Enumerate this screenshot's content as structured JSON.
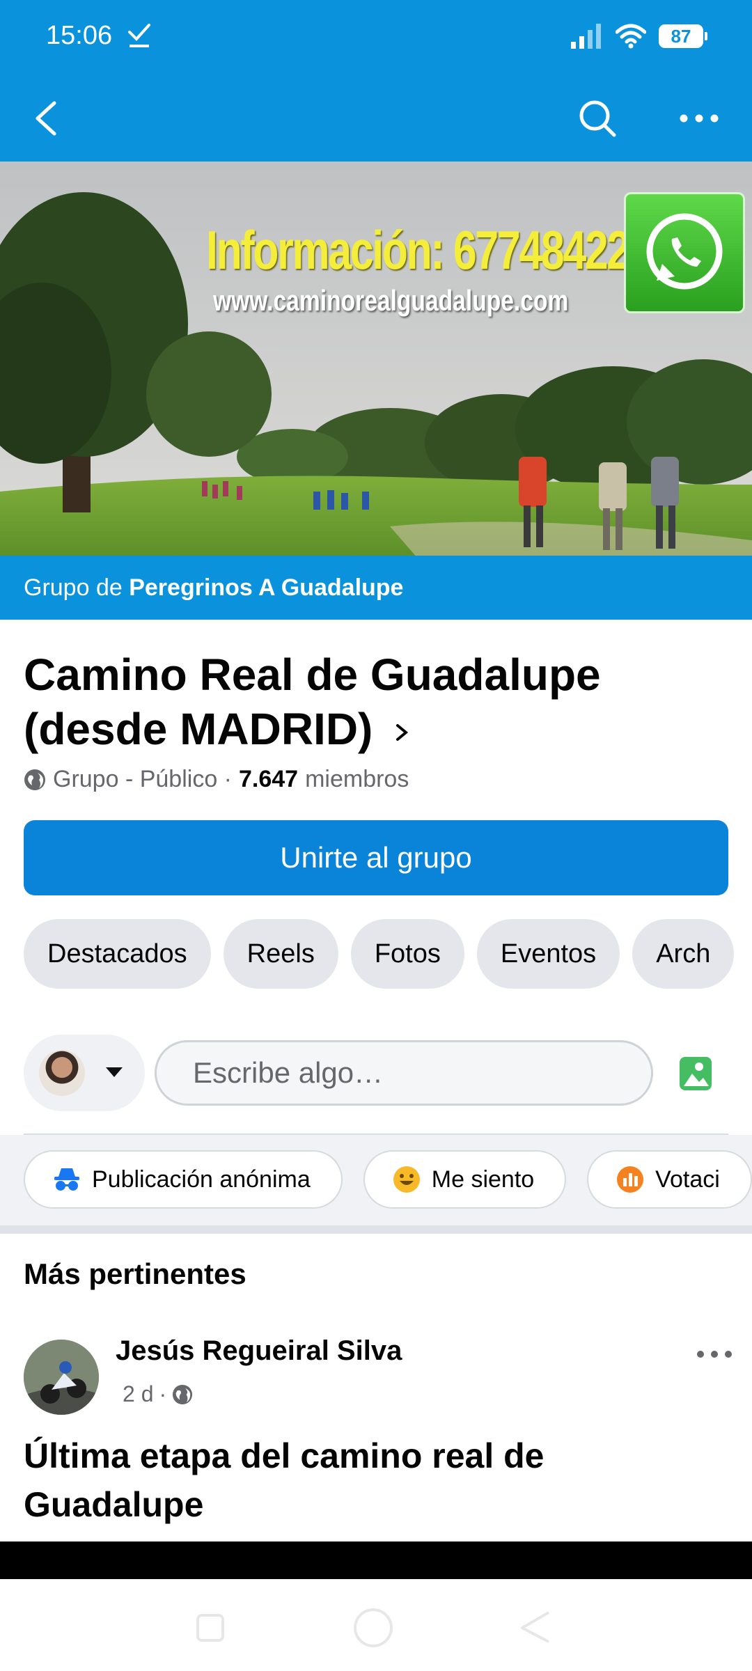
{
  "status_bar": {
    "time": "15:06",
    "battery": "87",
    "icons": [
      "check-icon",
      "signal-icon",
      "wifi-icon",
      "battery-icon"
    ]
  },
  "header": {
    "back_icon": "back-arrow-icon",
    "search_icon": "search-icon",
    "more_icon": "more-icon"
  },
  "cover": {
    "info_text": "Información: 677484227",
    "url_text": "www.caminorealguadalupe.com",
    "badge_icon": "whatsapp-icon"
  },
  "group_strip": {
    "prefix": "Grupo de ",
    "name": "Peregrinos A Guadalupe"
  },
  "group": {
    "title": "Camino Real de Guadalupe (desde MADRID)",
    "privacy": "Grupo - Público · ",
    "member_count": "7.647",
    "members_label": "miembros",
    "join_label": "Unirte al grupo"
  },
  "tabs": [
    "Destacados",
    "Reels",
    "Fotos",
    "Eventos",
    "Arch"
  ],
  "composer": {
    "placeholder": "Escribe algo…",
    "photo_icon": "photo-icon"
  },
  "actions": [
    {
      "label": "Publicación anónima",
      "icon": "incognito-icon",
      "color": "#1877f2"
    },
    {
      "label": "Me siento",
      "icon": "smiley-icon",
      "color": "#f7b928"
    },
    {
      "label": "Votaci",
      "icon": "poll-icon",
      "color": "#f5821f"
    }
  ],
  "feed": {
    "section_title": "Más pertinentes",
    "post": {
      "author": "Jesús Regueiral Silva",
      "time": "2 d",
      "separator": "·",
      "title": "Última etapa del camino real de Guadalupe"
    }
  },
  "colors": {
    "brand_blue": "#0a93dc",
    "button_blue": "#0a84d8",
    "chip_gray": "#e4e6eb"
  }
}
